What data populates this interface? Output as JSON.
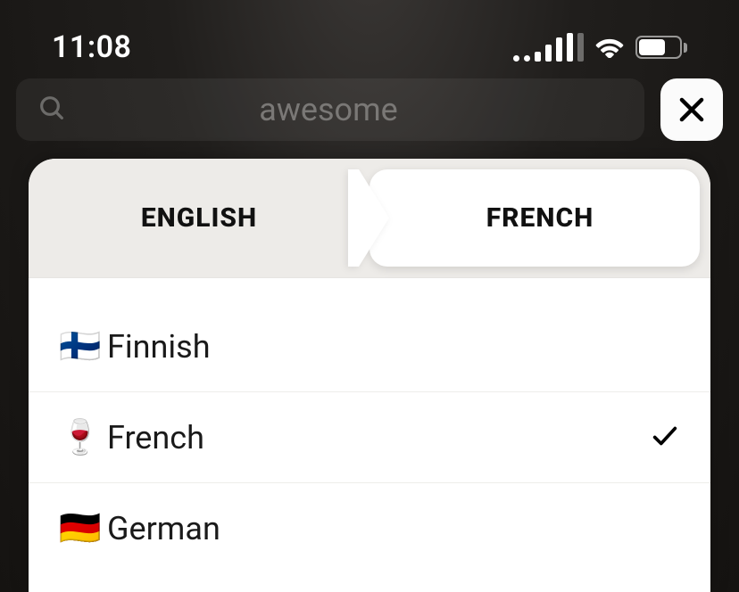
{
  "status": {
    "time": "11:08"
  },
  "search": {
    "value": "awesome"
  },
  "tabs": {
    "source": "ENGLISH",
    "target": "FRENCH"
  },
  "languages": [
    {
      "emoji": "🇫🇮",
      "label": "Finnish",
      "selected": false
    },
    {
      "emoji": "🍷",
      "label": "French",
      "selected": true
    },
    {
      "emoji": "🇩🇪",
      "label": "German",
      "selected": false
    }
  ]
}
